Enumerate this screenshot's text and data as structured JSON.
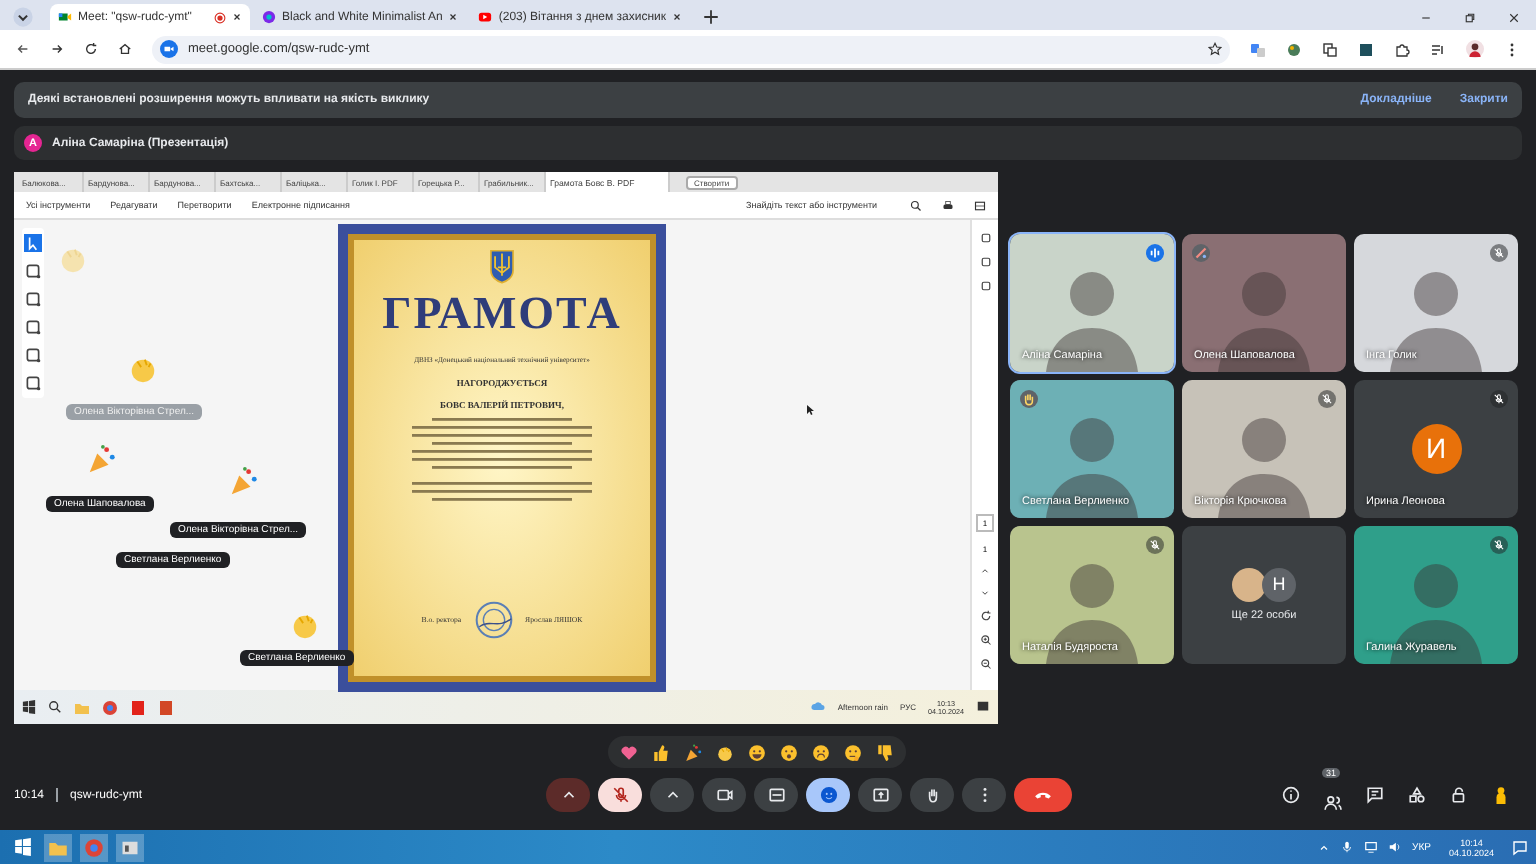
{
  "browser": {
    "tabs": [
      {
        "title": "Meet: \"qsw-rudc-ymt\"",
        "kind": "meet",
        "selected": true,
        "recording": true
      },
      {
        "title": "Black and White Minimalist An",
        "kind": "canva",
        "selected": false,
        "recording": false
      },
      {
        "title": "(203) Вітання з днем захисник",
        "kind": "youtube",
        "selected": false,
        "recording": false
      }
    ],
    "url": "meet.google.com/qsw-rudc-ymt"
  },
  "notice": {
    "text": "Деякі встановлені розширення можуть впливати на якість виклику",
    "actions": [
      "Докладніше",
      "Закрити"
    ]
  },
  "presenter": {
    "initial": "А",
    "name": "Аліна Самаріна (Презентація)"
  },
  "shared_screen": {
    "tabs": [
      {
        "title": "Балюкова...",
        "selected": false
      },
      {
        "title": "Бардунова...",
        "selected": false
      },
      {
        "title": "Бардунова...",
        "selected": false
      },
      {
        "title": "Бахтська...",
        "selected": false
      },
      {
        "title": "Баліцька...",
        "selected": false
      },
      {
        "title": "Голик І. PDF",
        "selected": false
      },
      {
        "title": "Горецька Р...",
        "selected": false
      },
      {
        "title": "Грабильник...",
        "selected": false
      },
      {
        "title": "Грамота Бовс В. PDF",
        "selected": true
      }
    ],
    "new_tab": "Створити",
    "toolbar": [
      "Усі інструменти",
      "Редагувати",
      "Перетворити",
      "Електронне підписання"
    ],
    "search": {
      "placeholder": "Знайдіть текст або інструменти"
    },
    "reaction_labels": [
      {
        "name": "Олена Вікторівна Стрел...",
        "faded": true
      },
      {
        "name": "Олена Шаповалова",
        "faded": false
      },
      {
        "name": "Олена Вікторівна Стрел...",
        "faded": false
      },
      {
        "name": "Светлана Верлиенко",
        "faded": false
      },
      {
        "name": "Светлана Верлиенко",
        "faded": false
      }
    ],
    "document": {
      "title": "ГРАМОТА",
      "institution": "ДВНЗ «Донецький національний технічний університет»",
      "heading": "НАГОРОДЖУЄТЬСЯ",
      "recipient": "БОВС ВАЛЕРІЙ ПЕТРОВИЧ,",
      "signer_role": "В.о. ректора",
      "signer": "Ярослав ЛЯШОК"
    },
    "page_number": "1",
    "page_total": "1",
    "taskbar": {
      "weather": "Afternoon rain",
      "language": "РУС",
      "time": "10:13",
      "date": "04.10.2024"
    }
  },
  "participants": [
    {
      "name": "Аліна Самаріна",
      "kind": "video",
      "speaking": true,
      "muted": false,
      "effects": false,
      "hand_raised": false
    },
    {
      "name": "Олена Шаповалова",
      "kind": "video",
      "speaking": false,
      "muted": false,
      "effects": true,
      "hand_raised": false
    },
    {
      "name": "Інга Голик",
      "kind": "video",
      "speaking": false,
      "muted": true,
      "effects": false,
      "hand_raised": false
    },
    {
      "name": "Светлана Верлиенко",
      "kind": "video",
      "speaking": false,
      "muted": false,
      "effects": false,
      "hand_raised": true
    },
    {
      "name": "Вікторія Крючкова",
      "kind": "video",
      "speaking": false,
      "muted": true,
      "effects": false,
      "hand_raised": false
    },
    {
      "name": "Ирина Леонова",
      "kind": "avatar",
      "initial": "И",
      "speaking": false,
      "muted": true,
      "effects": false,
      "hand_raised": false
    },
    {
      "name": "Наталія Будяроста",
      "kind": "video",
      "speaking": false,
      "muted": true,
      "effects": false,
      "hand_raised": false
    },
    {
      "name": "Ще 22 особи",
      "kind": "more",
      "initial": "Н"
    },
    {
      "name": "Галина Журавель",
      "kind": "video",
      "speaking": false,
      "muted": true,
      "effects": false,
      "hand_raised": false
    }
  ],
  "call": {
    "time": "10:14",
    "code": "qsw-rudc-ymt",
    "people_count": "31",
    "mic_on": false,
    "reactions_open": true
  },
  "taskbar": {
    "language": "УКР",
    "time": "10:14",
    "date": "04.10.2024"
  }
}
